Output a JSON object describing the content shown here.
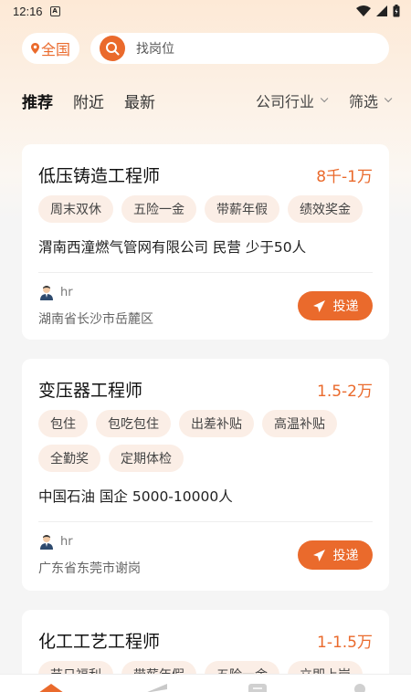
{
  "status_bar": {
    "time": "12:16",
    "notification_icon": "a-box-icon",
    "icons": [
      "wifi-icon",
      "signal-icon",
      "battery-icon"
    ]
  },
  "header": {
    "city": "全国",
    "search_placeholder": "找岗位"
  },
  "tabs": [
    {
      "label": "推荐",
      "active": true
    },
    {
      "label": "附近",
      "active": false
    },
    {
      "label": "最新",
      "active": false
    }
  ],
  "filters": {
    "industry": "公司行业",
    "screen": "筛选"
  },
  "jobs": [
    {
      "title": "低压铸造工程师",
      "salary": "8千-1万",
      "tags": [
        "周末双休",
        "五险一金",
        "带薪年假",
        "绩效奖金"
      ],
      "company": "渭南西潼燃气管网有限公司 民营 少于50人",
      "hr": "hr",
      "location": "湖南省长沙市岳麓区",
      "apply": "投递"
    },
    {
      "title": "变压器工程师",
      "salary": "1.5-2万",
      "tags": [
        "包住",
        "包吃包住",
        "出差补贴",
        "高温补贴",
        "全勤奖",
        "定期体检"
      ],
      "company": "中国石油 国企 5000-10000人",
      "hr": "hr",
      "location": "广东省东莞市谢岗",
      "apply": "投递"
    },
    {
      "title": "化工工艺工程师",
      "salary": "1-1.5万",
      "tags": [
        "节日福利",
        "带薪年假",
        "五险一金",
        "立即上岗"
      ]
    }
  ],
  "bottom_nav": [
    "home-icon",
    "send-icon",
    "message-icon",
    "profile-icon"
  ],
  "colors": {
    "accent": "#ea6a2c",
    "tag_bg": "#fbeee6"
  }
}
